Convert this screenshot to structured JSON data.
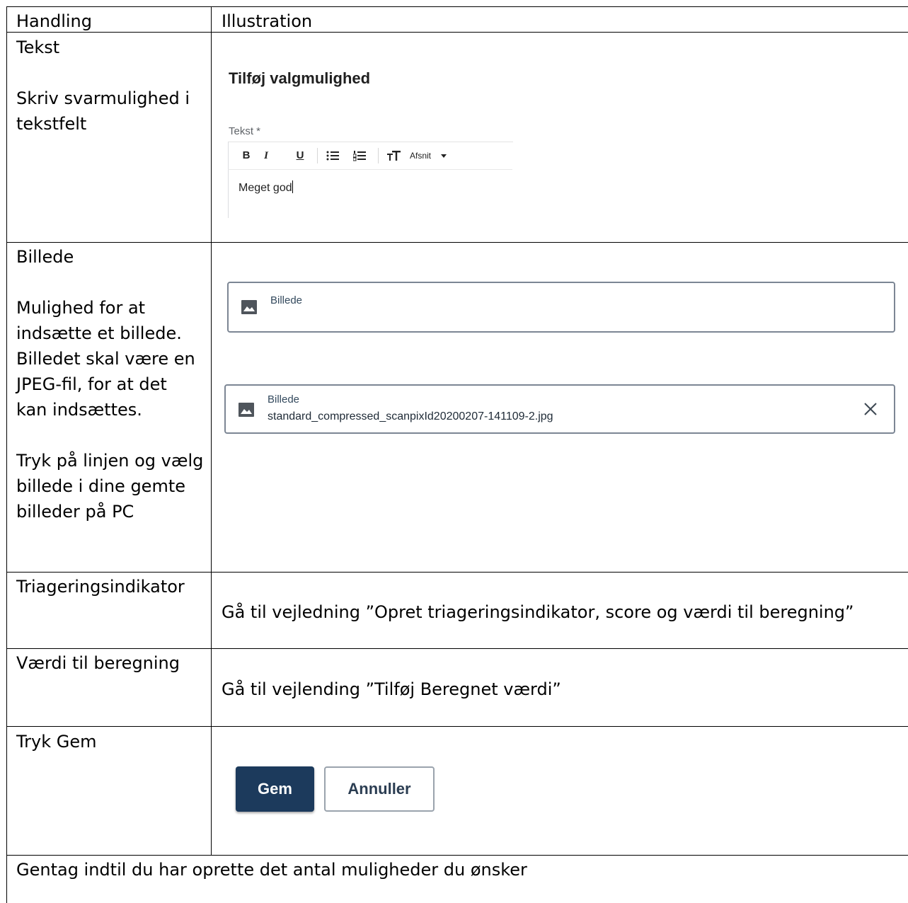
{
  "table": {
    "headers": {
      "col1": "Handling",
      "col2": "Illustration"
    },
    "rows": [
      {
        "action": "Tekst\n\nSkriv svarmulighed i\ntekstfelt"
      },
      {
        "action": "Billede\n\nMulighed for at\nindsætte et billede.\nBilledet skal være en\nJPEG-fil, for at det\nkan indsættes.\n\nTryk på linjen og vælg\nbillede i dine gemte\nbilleder på PC"
      },
      {
        "action": "Triageringsindikator",
        "illustration": "Gå til vejledning ”Opret triageringsindikator, score og værdi til beregning”"
      },
      {
        "action": "Værdi til beregning",
        "illustration": "Gå til vejlending ”Tilføj Beregnet værdi”"
      },
      {
        "action": "Tryk Gem"
      }
    ],
    "footer": "Gentag indtil du har oprette det antal muligheder du ønsker"
  },
  "editor": {
    "title": "Tilføj valgmulighed",
    "field_label": "Tekst *",
    "toolbar": {
      "bold": "B",
      "italic": "I",
      "underline": "U",
      "style_label": "Afsnit"
    },
    "value": "Meget god"
  },
  "image_fields": {
    "empty": {
      "label": "Billede"
    },
    "filled": {
      "label": "Billede",
      "filename": "standard_compressed_scanpixId20200207-141109-2.jpg"
    }
  },
  "buttons": {
    "save": "Gem",
    "cancel": "Annuller"
  },
  "colors": {
    "primary": "#1c3a5c",
    "field_border": "#7c8694",
    "text_dark": "#1e2a36"
  },
  "icons": [
    "image-icon",
    "close-icon",
    "bullet-list-icon",
    "numbered-list-icon",
    "text-size-icon",
    "caret-down-icon"
  ]
}
